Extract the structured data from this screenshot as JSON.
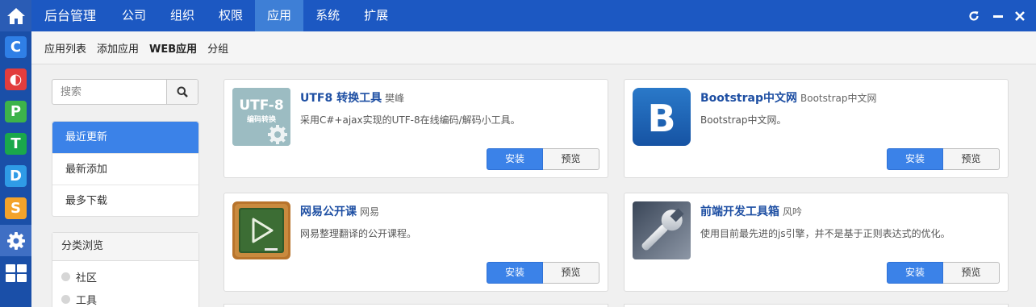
{
  "dock": {
    "apps": [
      {
        "letter": "C",
        "color": "#2f7fe6"
      },
      {
        "letter": "◐",
        "color": "#e23d3d"
      },
      {
        "letter": "P",
        "color": "#3db34a"
      },
      {
        "letter": "T",
        "color": "#1aa84b"
      },
      {
        "letter": "D",
        "color": "#2f9be6"
      },
      {
        "letter": "S",
        "color": "#f3a32b"
      }
    ]
  },
  "topbar": {
    "brand": "后台管理",
    "nav": [
      {
        "label": "公司"
      },
      {
        "label": "组织"
      },
      {
        "label": "权限"
      },
      {
        "label": "应用",
        "active": true
      },
      {
        "label": "系统"
      },
      {
        "label": "扩展"
      }
    ]
  },
  "subbar": {
    "items": [
      "应用列表",
      "添加应用",
      "WEB应用",
      "分组"
    ],
    "active_index": 2
  },
  "search": {
    "placeholder": "搜索"
  },
  "filters": [
    {
      "label": "最近更新",
      "active": true
    },
    {
      "label": "最新添加"
    },
    {
      "label": "最多下载"
    }
  ],
  "categories": {
    "title": "分类浏览",
    "items": [
      "社区",
      "工具"
    ]
  },
  "apps": [
    {
      "name": "UTF8 转换工具",
      "author": "樊峰",
      "desc": "采用C#+ajax实现的UTF-8在线编码/解码小工具。",
      "thumb_title": "UTF-8",
      "thumb_sub": "编码转换",
      "icon": "utf8-converter-icon",
      "install": "安装",
      "preview": "预览"
    },
    {
      "name": "Bootstrap中文网",
      "author": "Bootstrap中文网",
      "desc": "Bootstrap中文网。",
      "thumb_letter": "B",
      "icon": "bootstrap-icon",
      "install": "安装",
      "preview": "预览"
    },
    {
      "name": "网易公开课",
      "author": "网易",
      "desc": "网易整理翻译的公开课程。",
      "icon": "chalkboard-play-icon",
      "install": "安装",
      "preview": "预览"
    },
    {
      "name": "前端开发工具箱",
      "author": "风吟",
      "desc": "使用目前最先进的js引擎，并不是基于正则表达式的优化。",
      "icon": "wrench-icon",
      "install": "安装",
      "preview": "预览"
    }
  ]
}
